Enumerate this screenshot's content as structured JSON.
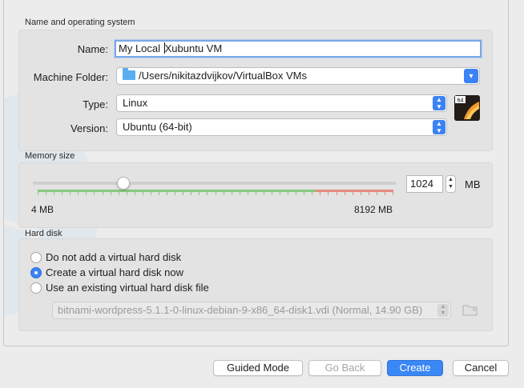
{
  "sections": {
    "name_os": "Name and operating system",
    "memory": "Memory size",
    "hard_disk": "Hard disk"
  },
  "form": {
    "name_label": "Name:",
    "name_value_before_caret": "My Local ",
    "name_value_after_caret": "Xubuntu VM",
    "folder_label": "Machine Folder:",
    "folder_value": "/Users/nikitazdvijkov/VirtualBox VMs",
    "type_label": "Type:",
    "type_value": "Linux",
    "version_label": "Version:",
    "version_value": "Ubuntu (64-bit)",
    "os_badge": "64"
  },
  "memory": {
    "value": "1024",
    "unit": "MB",
    "min_label": "4 MB",
    "max_label": "8192 MB",
    "min": 4,
    "max": 8192,
    "current": 1024,
    "recommended_max": 6400
  },
  "hard_disk": {
    "options": [
      {
        "label": "Do not add a virtual hard disk",
        "selected": false
      },
      {
        "label": "Create a virtual hard disk now",
        "selected": true
      },
      {
        "label": "Use an existing virtual hard disk file",
        "selected": false
      }
    ],
    "existing_file": "bitnami-wordpress-5.1.1-0-linux-debian-9-x86_64-disk1.vdi (Normal, 14.90 GB)"
  },
  "buttons": {
    "guided": "Guided Mode",
    "back": "Go Back",
    "create": "Create",
    "cancel": "Cancel"
  },
  "colors": {
    "accent": "#3b82f6",
    "ok_ticks": "#86c97d",
    "warn_ticks": "#e58a80"
  }
}
